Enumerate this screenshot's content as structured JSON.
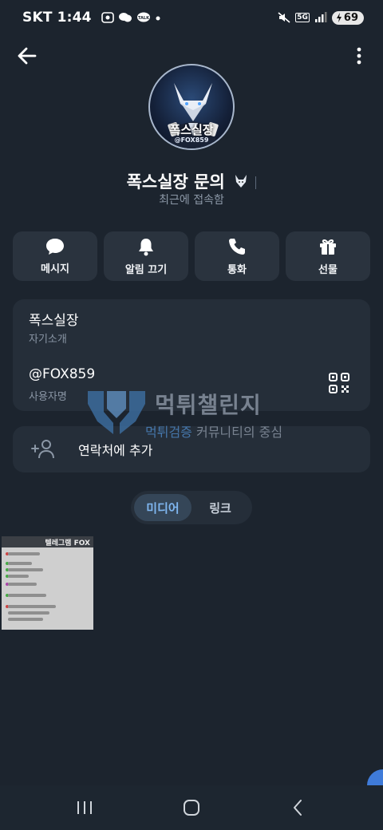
{
  "status_bar": {
    "carrier": "SKT",
    "time": "1:44",
    "network": "5G",
    "battery": "69"
  },
  "profile": {
    "avatar_text": "폭스실장",
    "avatar_handle": "@FOX859",
    "name": "폭스실장 문의",
    "last_seen": "최근에 접속함"
  },
  "actions": [
    {
      "label": "메시지",
      "icon": "chat-bubble-icon"
    },
    {
      "label": "알림 끄기",
      "icon": "bell-icon"
    },
    {
      "label": "통화",
      "icon": "phone-icon"
    },
    {
      "label": "선물",
      "icon": "gift-icon"
    }
  ],
  "info": {
    "bio_value": "폭스실장",
    "bio_label": "자기소개",
    "username_value": "@FOX859",
    "username_label": "사용자명"
  },
  "contact": {
    "add_label": "연락처에 추가"
  },
  "watermark": {
    "title": "먹튀챌린지",
    "subtitle_highlight": "먹튀검증",
    "subtitle_rest": " 커뮤니티의 중심"
  },
  "tabs": {
    "media": "미디어",
    "links": "링크",
    "active": "미디어"
  },
  "media": {
    "thumb_title": "텔레그램 FOX"
  },
  "colors": {
    "background": "#1c242e",
    "card": "#252e39",
    "accent": "#7fb6f0"
  }
}
